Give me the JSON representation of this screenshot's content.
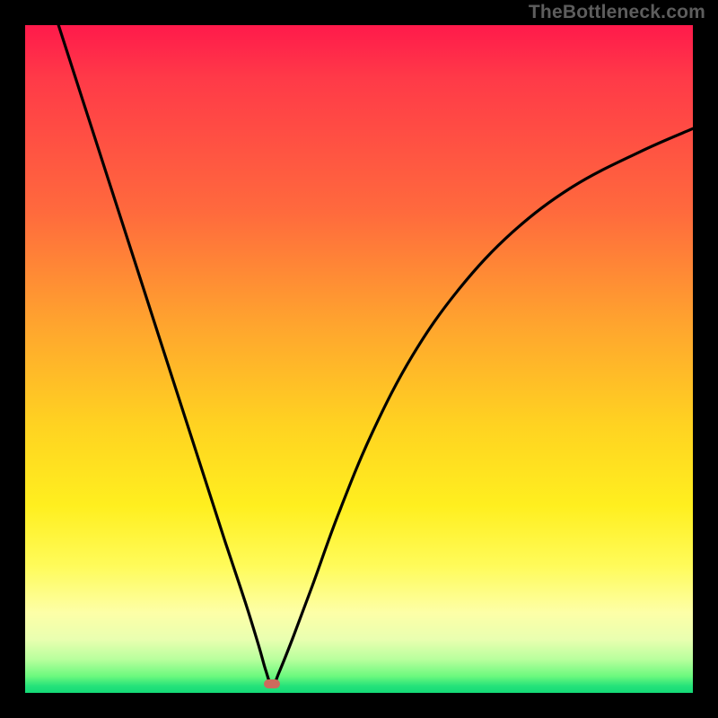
{
  "watermark": "TheBottleneck.com",
  "chart_data": {
    "type": "line",
    "title": "",
    "xlabel": "",
    "ylabel": "",
    "xlim": [
      0,
      100
    ],
    "ylim": [
      0,
      100
    ],
    "grid": false,
    "legend": false,
    "description": "V-shaped bottleneck curve over a vertical traffic-light gradient (red at top = high bottleneck, green at bottom = no bottleneck). Curve minimum touches the bottom near x≈37.",
    "series": [
      {
        "name": "bottleneck-curve",
        "x": [
          5,
          10,
          15,
          20,
          25,
          30,
          33,
          35,
          36,
          37,
          38,
          40,
          43,
          47,
          52,
          58,
          65,
          73,
          82,
          92,
          100
        ],
        "values": [
          100,
          84.5,
          69,
          53.5,
          38,
          22.5,
          13.5,
          7,
          3.5,
          1,
          3,
          8,
          16,
          27,
          39,
          50.5,
          60.5,
          69,
          75.8,
          81,
          84.5
        ]
      }
    ],
    "marker": {
      "x": 37,
      "y": 1.3
    },
    "gradient_stops": [
      {
        "pct": 0,
        "color": "#ff1a4b"
      },
      {
        "pct": 28,
        "color": "#ff6a3d"
      },
      {
        "pct": 60,
        "color": "#ffd321"
      },
      {
        "pct": 88,
        "color": "#fdffa7"
      },
      {
        "pct": 100,
        "color": "#14da77"
      }
    ]
  }
}
